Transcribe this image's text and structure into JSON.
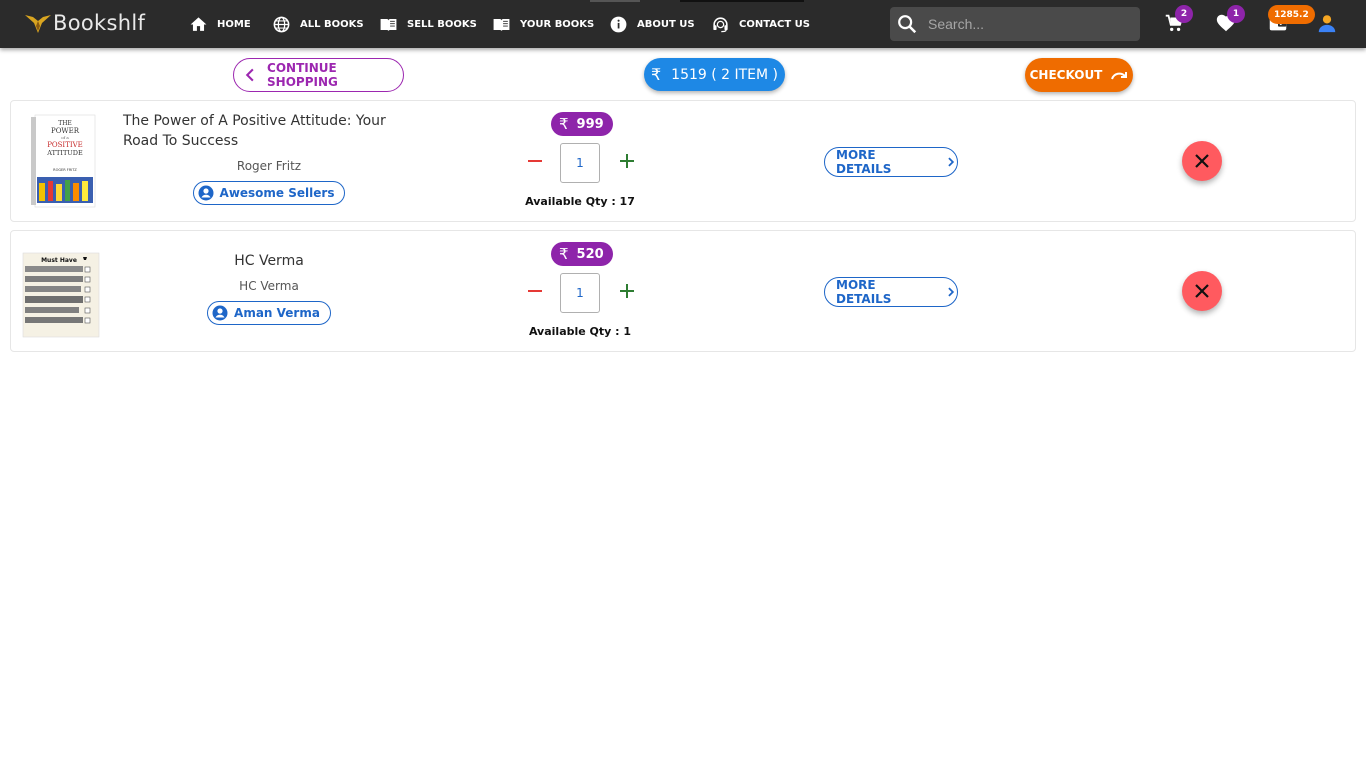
{
  "brand": {
    "name": "Bookshlf"
  },
  "nav": {
    "items": [
      {
        "label": "HOME",
        "icon": "home-icon"
      },
      {
        "label": "ALL BOOKS",
        "icon": "globe-icon"
      },
      {
        "label": "SELL BOOKS",
        "icon": "book-open-icon"
      },
      {
        "label": "YOUR BOOKS",
        "icon": "book-open-icon"
      },
      {
        "label": "ABOUT US",
        "icon": "info-icon"
      },
      {
        "label": "CONTACT US",
        "icon": "support-agent-icon"
      }
    ]
  },
  "search": {
    "placeholder": "Search..."
  },
  "header_icons": {
    "cart_count": "2",
    "wishlist_count": "1",
    "wallet_balance": "1285.2"
  },
  "actions": {
    "continue_label": "CONTINUE SHOPPING",
    "total_label": "1519 ( 2 ITEM )",
    "currency_symbol": "₹",
    "checkout_label": "CHECKOUT"
  },
  "cart": {
    "items": [
      {
        "title": "The Power of A Positive Attitude: Your Road To Success",
        "author": "Roger Fritz",
        "seller": "Awesome Sellers",
        "price": "999",
        "qty": "1",
        "available": "Available Qty : 17",
        "more_label": "MORE DETAILS",
        "cover_text": [
          "THE",
          "POWER",
          "of a",
          "POSITIVE",
          "ATTITUDE",
          "ROGER FRITZ"
        ]
      },
      {
        "title": "HC Verma",
        "author": "HC Verma",
        "seller": "Aman Verma",
        "price": "520",
        "qty": "1",
        "available": "Available Qty : 1",
        "more_label": "MORE DETAILS",
        "cover_text": [
          "Must Have"
        ]
      }
    ]
  },
  "colors": {
    "navbar": "#2b2b2b",
    "accent_purple": "#8e24aa",
    "accent_blue": "#1e88e5",
    "accent_orange": "#ef6c00",
    "remove_red": "#ff5a5f"
  }
}
